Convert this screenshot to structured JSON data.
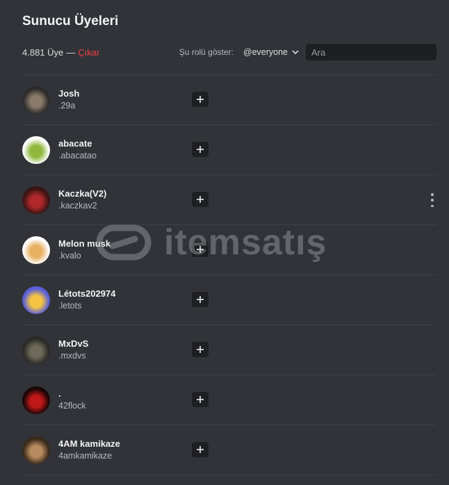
{
  "header": {
    "title": "Sunucu Üyeleri",
    "member_count": "4.881 Üye",
    "separator": "—",
    "kick_label": "Çıkar",
    "role_filter_label": "Şu rolü göster:",
    "role_filter_value": "@everyone",
    "search_placeholder": "Ara"
  },
  "members": [
    {
      "display": "Josh",
      "username": ".29a",
      "avatar_colors": [
        "#2b2b2b",
        "#8a7a6a"
      ]
    },
    {
      "display": "abacate",
      "username": ".abacatao",
      "avatar_colors": [
        "#ffffff",
        "#8fb83c"
      ]
    },
    {
      "display": "Kaczka(V2)",
      "username": ".kaczkav2",
      "avatar_colors": [
        "#3a1414",
        "#b0282a"
      ]
    },
    {
      "display": "Melon musk",
      "username": ".kvalo",
      "avatar_colors": [
        "#ffffff",
        "#e8b062"
      ]
    },
    {
      "display": "Létots202974",
      "username": ".letots",
      "avatar_colors": [
        "#5a5fd8",
        "#f5c542"
      ]
    },
    {
      "display": "MxDvS",
      "username": ".mxdvs",
      "avatar_colors": [
        "#2a2a26",
        "#6e6a5a"
      ]
    },
    {
      "display": ".",
      "username": "42flock",
      "avatar_colors": [
        "#1a0606",
        "#c01818"
      ]
    },
    {
      "display": "4AM kamikaze",
      "username": "4amkamikaze",
      "avatar_colors": [
        "#3a2a1a",
        "#b88a60"
      ]
    }
  ],
  "icons": {
    "search": "search-icon",
    "chevron": "chevron-down-icon",
    "add_role": "plus-icon",
    "more": "more-vertical-icon"
  },
  "watermark": {
    "text": "itemsatış"
  },
  "colors": {
    "background": "#313338",
    "kick": "#f23f43",
    "input_bg": "#1e1f22"
  }
}
